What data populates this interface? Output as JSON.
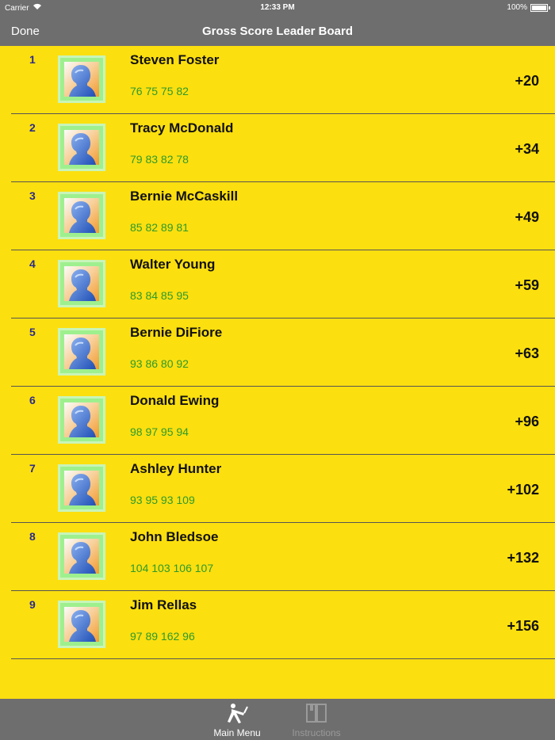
{
  "status": {
    "carrier": "Carrier",
    "time": "12:33 PM",
    "battery": "100%"
  },
  "nav": {
    "done": "Done",
    "title": "Gross Score Leader Board"
  },
  "leaders": [
    {
      "rank": "1",
      "name": "Steven Foster",
      "scores": "76 75 75 82",
      "total": "+20"
    },
    {
      "rank": "2",
      "name": "Tracy McDonald",
      "scores": "79 83 82 78",
      "total": "+34"
    },
    {
      "rank": "3",
      "name": "Bernie McCaskill",
      "scores": "85 82 89 81",
      "total": "+49"
    },
    {
      "rank": "4",
      "name": "Walter Young",
      "scores": "83 84 85 95",
      "total": "+59"
    },
    {
      "rank": "5",
      "name": "Bernie DiFiore",
      "scores": "93 86 80 92",
      "total": "+63"
    },
    {
      "rank": "6",
      "name": "Donald Ewing",
      "scores": "98 97 95 94",
      "total": "+96"
    },
    {
      "rank": "7",
      "name": "Ashley Hunter",
      "scores": "93 95 93 109",
      "total": "+102"
    },
    {
      "rank": "8",
      "name": "John Bledsoe",
      "scores": "104 103 106 107",
      "total": "+132"
    },
    {
      "rank": "9",
      "name": "Jim Rellas",
      "scores": "97 89 162 96",
      "total": "+156"
    }
  ],
  "tabs": {
    "main_menu": "Main Menu",
    "instructions": "Instructions"
  },
  "icons": {
    "avatar": "person-head-icon",
    "main_menu": "golfer-icon",
    "instructions": "book-icon",
    "signal": "wifi-icon"
  },
  "colors": {
    "background": "#fcdf0f",
    "bar": "#6e6e6e",
    "scores": "#2c9a2c",
    "rank": "#2b2b8a"
  }
}
